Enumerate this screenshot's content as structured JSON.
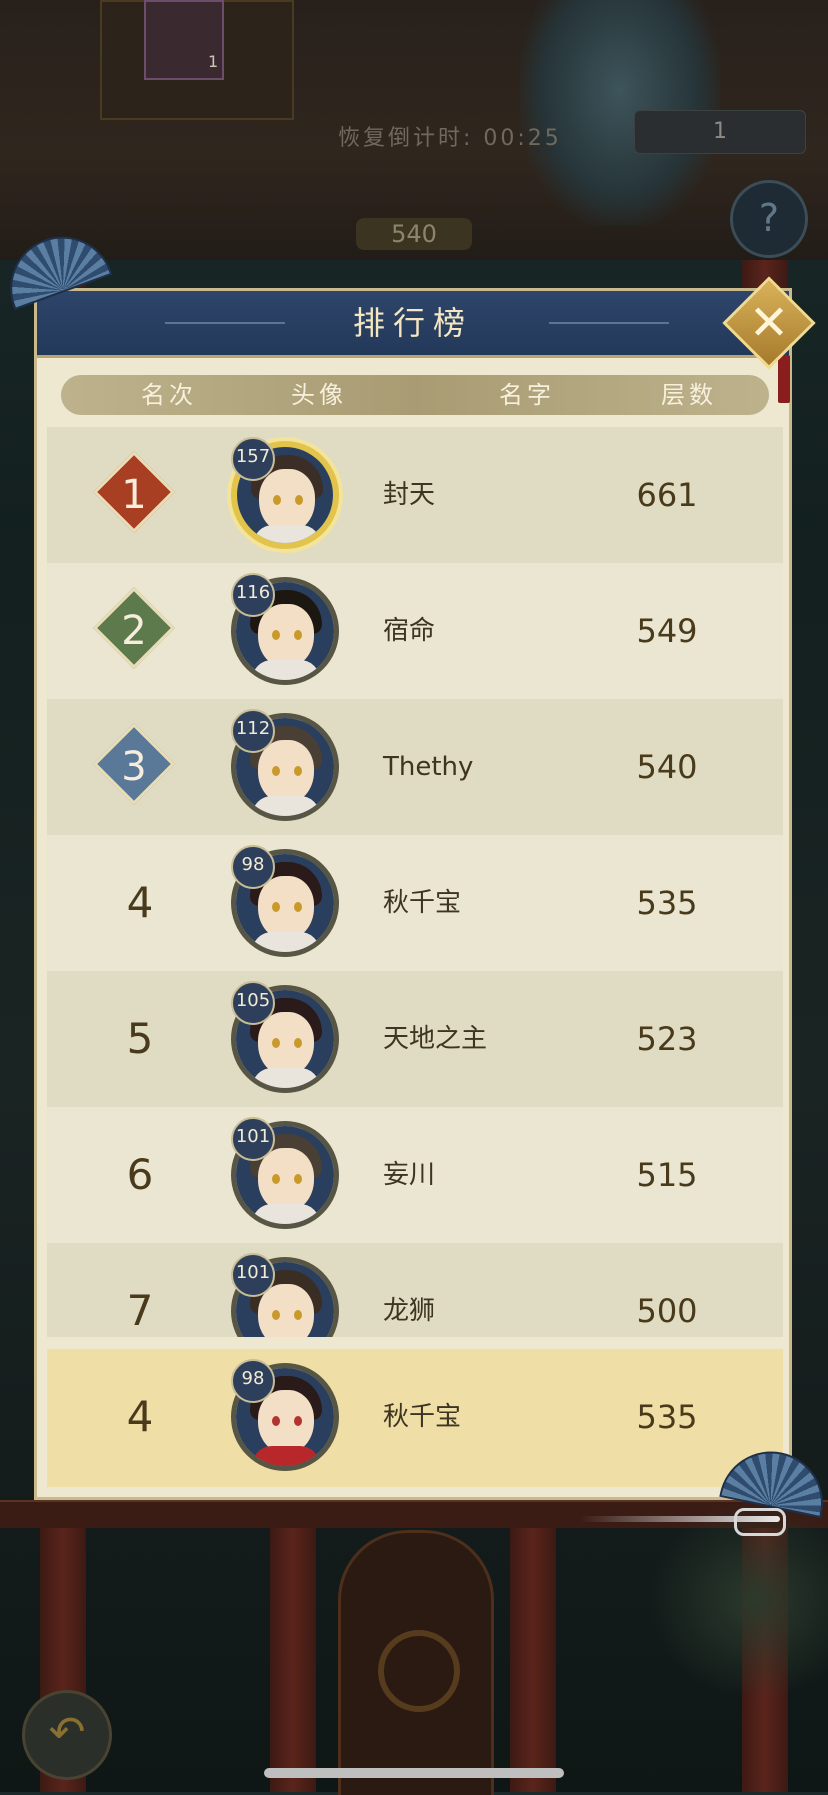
{
  "background": {
    "item_count": "1",
    "timer_text": "恢复倒计时: 00:25",
    "floor_plaque": "540",
    "resource_count": "1",
    "help_symbol": "?",
    "back_symbol": "↶"
  },
  "leaderboard": {
    "title": "排行榜",
    "close_symbol": "✕",
    "columns": {
      "rank": "名次",
      "avatar": "头像",
      "name": "名字",
      "floors": "层数"
    },
    "rows": [
      {
        "rank": "1",
        "level": "157",
        "name": "封天",
        "floors": "661",
        "rank_color": "#a83e22",
        "avatar_hair": "#3b2e26",
        "frame": "gold"
      },
      {
        "rank": "2",
        "level": "116",
        "name": "宿命",
        "floors": "549",
        "rank_color": "#5d7a4c",
        "avatar_hair": "#1d1712",
        "frame": "plain"
      },
      {
        "rank": "3",
        "level": "112",
        "name": "Thethy",
        "floors": "540",
        "rank_color": "#5a7898",
        "avatar_hair": "#4a3f35",
        "frame": "plain"
      },
      {
        "rank": "4",
        "level": "98",
        "name": "秋千宝",
        "floors": "535",
        "avatar_hair": "#2a1a1a",
        "frame": "plain"
      },
      {
        "rank": "5",
        "level": "105",
        "name": "天地之主",
        "floors": "523",
        "avatar_hair": "#2a1a1a",
        "frame": "plain"
      },
      {
        "rank": "6",
        "level": "101",
        "name": "妄川",
        "floors": "515",
        "avatar_hair": "#4a3f35",
        "frame": "plain"
      },
      {
        "rank": "7",
        "level": "101",
        "name": "龙狮",
        "floors": "500",
        "avatar_hair": "#3a2d24",
        "frame": "plain"
      }
    ],
    "self": {
      "rank": "4",
      "level": "98",
      "name": "秋千宝",
      "floors": "535"
    }
  }
}
